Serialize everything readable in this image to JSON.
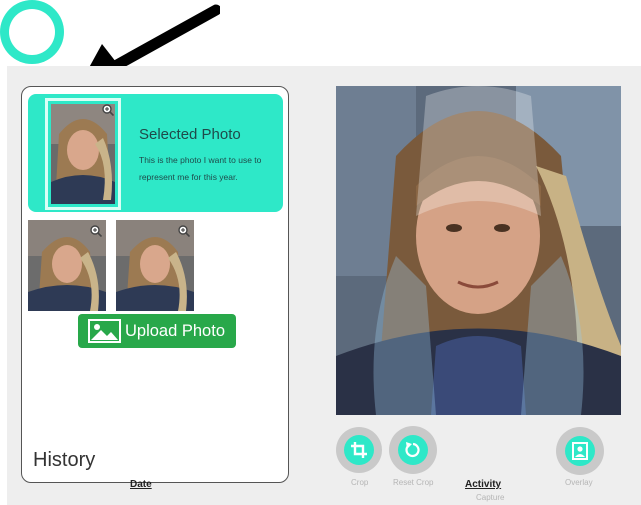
{
  "selected_card": {
    "title": "Selected Photo",
    "description": "This is the photo I want to use to represent me for this year."
  },
  "upload": {
    "label": "Upload Photo"
  },
  "history": {
    "label": "History"
  },
  "table": {
    "date_column": "Date",
    "activity_column": "Activity"
  },
  "controls": {
    "crop": "Crop",
    "reset_crop": "Reset Crop",
    "capture": "Capture",
    "overlay": "Overlay"
  },
  "icons": {
    "zoom": "zoom-in-icon",
    "upload": "image-icon",
    "crop": "crop-icon",
    "reset": "reset-icon",
    "overlay": "portrait-icon"
  },
  "colors": {
    "accent": "#2ee8c8",
    "upload_green": "#28a84a",
    "control_grey": "#c9c9c9"
  }
}
